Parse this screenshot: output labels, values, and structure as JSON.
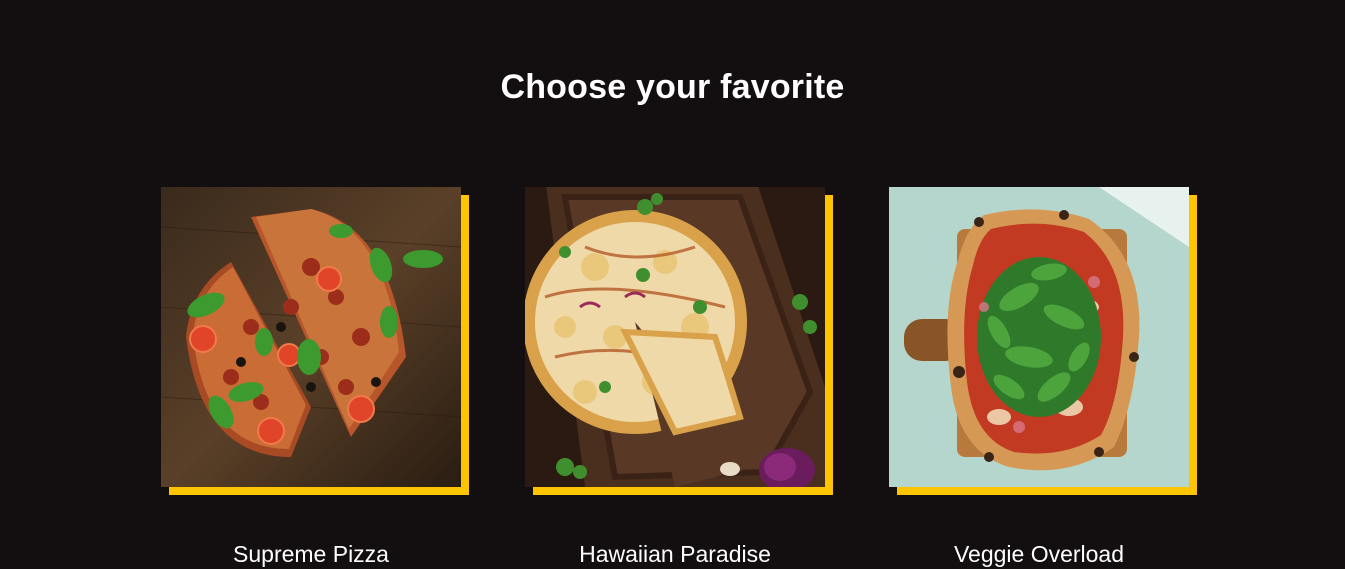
{
  "section": {
    "title": "Choose your favorite"
  },
  "colors": {
    "background": "#130e0f",
    "accent": "#ffc400",
    "text": "#ffffff"
  },
  "cards": [
    {
      "title": "Supreme Pizza",
      "image": "supreme-pizza-photo"
    },
    {
      "title": "Hawaiian Paradise",
      "image": "hawaiian-pizza-photo"
    },
    {
      "title": "Veggie Overload",
      "image": "veggie-pizza-photo"
    }
  ]
}
